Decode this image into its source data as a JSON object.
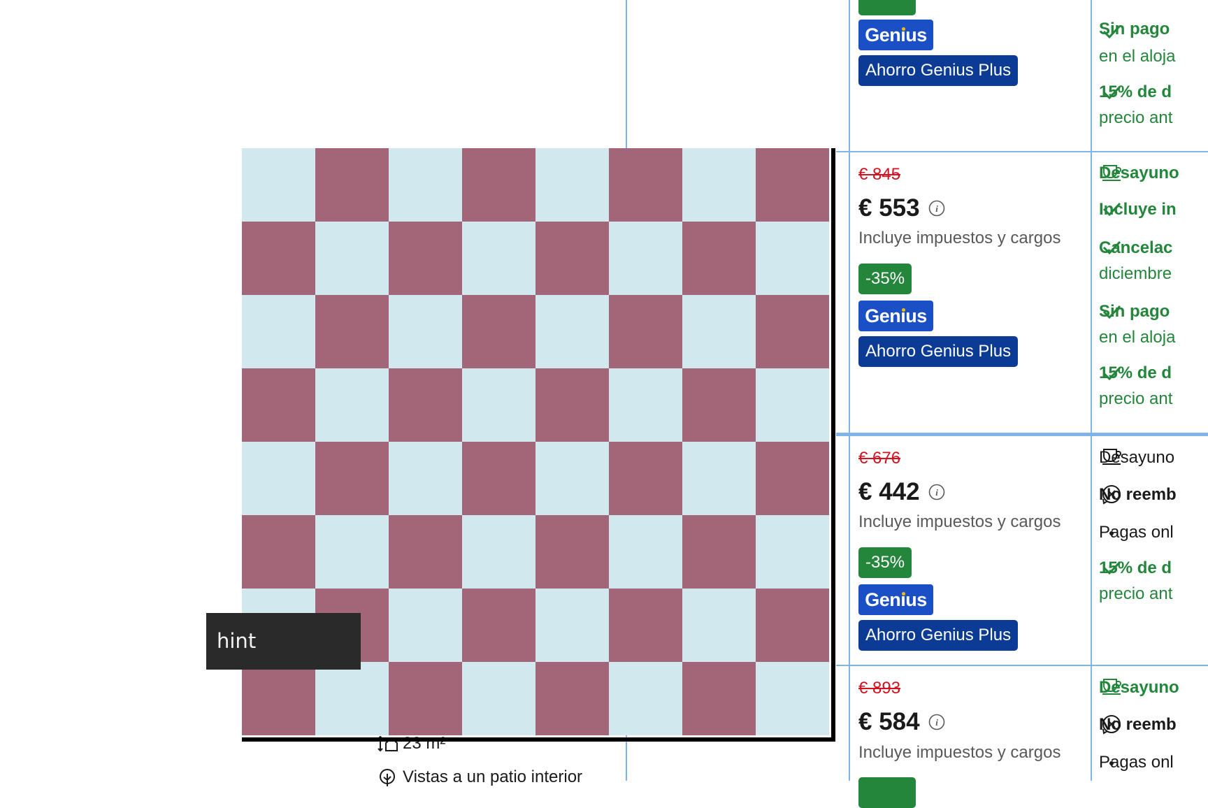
{
  "partial_top": {
    "genius_label": "Genius",
    "plus_label": "Ahorro Genius Plus",
    "conditions": [
      {
        "title": "Sin pago",
        "sub": "en el aloja"
      },
      {
        "title": "15% de d",
        "sub": "precio ant"
      }
    ]
  },
  "rows": [
    {
      "old_price": "€ 845",
      "price": "€ 553",
      "taxes": "Incluye impuestos y cargos",
      "discount": "-35%",
      "genius": "Genius",
      "plus": "Ahorro Genius Plus",
      "conditions": {
        "breakfast": "Desayuno",
        "includes": "Incluye in",
        "cancel_title": "Cancelac",
        "cancel_sub": "diciembre",
        "nopay_title": "Sin pago",
        "nopay_sub": "en el aloja",
        "pct_title": "15% de d",
        "pct_sub": "precio ant"
      }
    },
    {
      "old_price": "€ 676",
      "price": "€ 442",
      "taxes": "Incluye impuestos y cargos",
      "discount": "-35%",
      "genius": "Genius",
      "plus": "Ahorro Genius Plus",
      "conditions": {
        "breakfast": "Desayuno",
        "nonref": "No reemb",
        "payonline": "Pagas onl",
        "pct_title": "15% de d",
        "pct_sub": "precio ant"
      }
    },
    {
      "old_price": "€ 893",
      "price": "€ 584",
      "taxes": "Incluye impuestos y cargos",
      "conditions": {
        "breakfast": "Desayuno",
        "nonref": "No reemb",
        "payonline": "Pagas onl"
      }
    }
  ],
  "room": {
    "size": "23 m²",
    "view": "Vistas a un patio interior"
  },
  "overlay": {
    "hint": "hint",
    "board_colors": {
      "light": "#d1e8ef",
      "dark": "#a36678"
    }
  },
  "icons": [
    "check-icon",
    "cup-icon",
    "info-icon",
    "no-refund-icon",
    "size-icon",
    "tree-icon"
  ],
  "colors": {
    "green": "#23863b",
    "red": "#d4111e",
    "genius_blue": "#1a4fc6",
    "plus_blue": "#0c3b96",
    "table_line": "#7fb3ea"
  }
}
